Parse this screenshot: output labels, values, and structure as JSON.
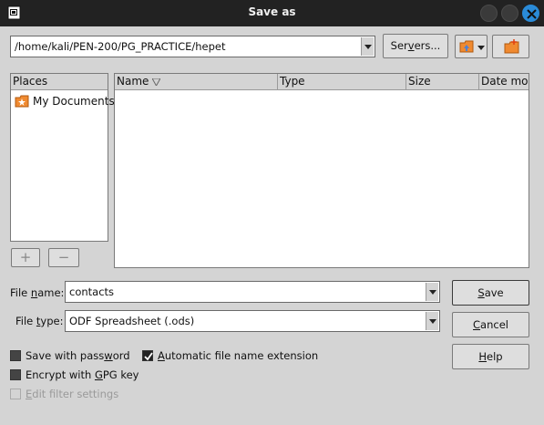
{
  "window": {
    "title": "Save as"
  },
  "path": {
    "value": "/home/kali/PEN-200/PG_PRACTICE/hepet"
  },
  "toolbar": {
    "servers_label_pre": "Ser",
    "servers_label_ul": "v",
    "servers_label_post": "ers..."
  },
  "places": {
    "header": "Places",
    "items": [
      {
        "label": "My Documents",
        "icon": "documents-folder-icon"
      }
    ]
  },
  "place_buttons": {
    "add": "+",
    "remove": "−"
  },
  "files": {
    "columns": [
      "Name",
      "Type",
      "Size",
      "Date modi"
    ],
    "rows": []
  },
  "filename": {
    "label_pre": "File ",
    "label_ul": "n",
    "label_post": "ame:",
    "value": "contacts"
  },
  "filetype": {
    "label_pre": "File ",
    "label_ul": "t",
    "label_post": "ype:",
    "value": "ODF Spreadsheet (.ods)"
  },
  "buttons": {
    "save_ul": "S",
    "save_post": "ave",
    "cancel_ul": "C",
    "cancel_post": "ancel",
    "help_ul": "H",
    "help_post": "elp"
  },
  "options": {
    "save_password": {
      "pre": "Save with pass",
      "ul": "w",
      "post": "ord",
      "checked": false
    },
    "auto_ext": {
      "pre": "",
      "ul": "A",
      "post": "utomatic file name extension",
      "checked": true
    },
    "encrypt_gpg": {
      "pre": "Encrypt with ",
      "ul": "G",
      "post": "PG key",
      "checked": false
    },
    "edit_filter": {
      "pre": "",
      "ul": "E",
      "post": "dit filter settings",
      "checked": false,
      "disabled": true
    }
  },
  "colors": {
    "accent": "#2a8bd8",
    "titlebar": "#222222",
    "dialog_bg": "#d4d4d4"
  }
}
